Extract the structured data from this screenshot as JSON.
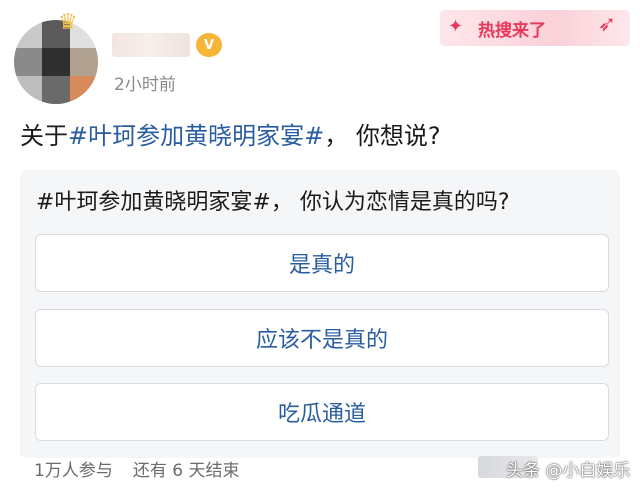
{
  "header": {
    "timestamp": "2小时前",
    "hot_banner": "热搜来了"
  },
  "post": {
    "question_prefix": "关于",
    "topic": "#叶珂参加黄晓明家宴#",
    "question_suffix": "， 你想说?"
  },
  "poll": {
    "title": "#叶珂参加黄晓明家宴#， 你认为恋情是真的吗?",
    "options": [
      {
        "label": "是真的"
      },
      {
        "label": "应该不是真的"
      },
      {
        "label": "吃瓜通道"
      }
    ],
    "participants": "1万人参与",
    "remaining": "还有 6 天结束"
  },
  "watermark": "头条 @小白娱乐",
  "colors": {
    "link_blue": "#2a5d9f",
    "hot_red": "#e8385c",
    "card_bg": "#f5f6f8"
  },
  "icons": {
    "crown": "crown-icon",
    "vip": "vip-badge-icon",
    "bird": "swallow-icon"
  }
}
